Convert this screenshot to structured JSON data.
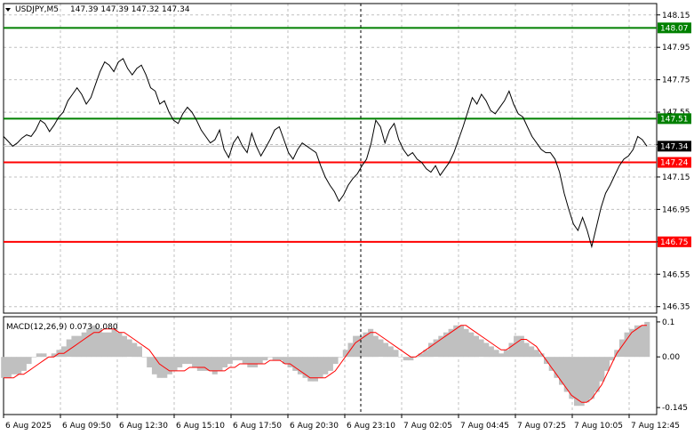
{
  "header": {
    "symbol": "USDJPY,M5",
    "ohlc": "147.39 147.39 147.32 147.34"
  },
  "macd": {
    "title": "MACD(12,26,9) 0.073 0.080",
    "ticks": [
      "0.1",
      "0.00",
      "-0.145"
    ]
  },
  "price_axis": {
    "ticks": [
      "148.15",
      "147.95",
      "147.75",
      "147.55",
      "147.35",
      "147.15",
      "146.95",
      "146.75",
      "146.55",
      "146.35"
    ],
    "range": [
      146.31,
      148.22
    ]
  },
  "time_axis": {
    "labels": [
      "6 Aug 2025",
      "6 Aug 09:50",
      "6 Aug 12:30",
      "6 Aug 15:10",
      "6 Aug 17:50",
      "6 Aug 20:30",
      "6 Aug 23:10",
      "7 Aug 02:05",
      "7 Aug 04:45",
      "7 Aug 07:25",
      "7 Aug 10:05",
      "7 Aug 12:45"
    ]
  },
  "levels": [
    {
      "label": "148.07",
      "value": 148.07,
      "color": "#008000"
    },
    {
      "label": "147.51",
      "value": 147.51,
      "color": "#008000"
    },
    {
      "label": "147.34",
      "value": 147.34,
      "color": "#000000"
    },
    {
      "label": "147.24",
      "value": 147.24,
      "color": "#ff0000"
    },
    {
      "label": "146.75",
      "value": 146.75,
      "color": "#ff0000"
    }
  ],
  "chart_data": {
    "type": "line",
    "series": [
      {
        "values": [
          147.4,
          147.37,
          147.34,
          147.36,
          147.39,
          147.41,
          147.4,
          147.44,
          147.5,
          147.48,
          147.43,
          147.47,
          147.52,
          147.55,
          147.62,
          147.66,
          147.7,
          147.66,
          147.6,
          147.64,
          147.72,
          147.8,
          147.86,
          147.84,
          147.8,
          147.86,
          147.88,
          147.82,
          147.78,
          147.82,
          147.84,
          147.78,
          147.7,
          147.68,
          147.6,
          147.62,
          147.55,
          147.5,
          147.48,
          147.54,
          147.58,
          147.55,
          147.5,
          147.44,
          147.4,
          147.36,
          147.38,
          147.44,
          147.32,
          147.27,
          147.36,
          147.4,
          147.34,
          147.3,
          147.42,
          147.34,
          147.28,
          147.33,
          147.38,
          147.44,
          147.46,
          147.38,
          147.3,
          147.26,
          147.32,
          147.36,
          147.34,
          147.32,
          147.3,
          147.22,
          147.15,
          147.1,
          147.06,
          147.0,
          147.04,
          147.1,
          147.14,
          147.17,
          147.22,
          147.26,
          147.36,
          147.5,
          147.46,
          147.36,
          147.44,
          147.48,
          147.38,
          147.32,
          147.28,
          147.3,
          147.26,
          147.24,
          147.2,
          147.18,
          147.22,
          147.16,
          147.2,
          147.24,
          147.3,
          147.38,
          147.46,
          147.55,
          147.64,
          147.6,
          147.66,
          147.62,
          147.56,
          147.54,
          147.58,
          147.62,
          147.68,
          147.6,
          147.54,
          147.52,
          147.46,
          147.4,
          147.36,
          147.32,
          147.3,
          147.3,
          147.26,
          147.18,
          147.05,
          146.95,
          146.86,
          146.82,
          146.9,
          146.82,
          146.72,
          146.84,
          146.96,
          147.05,
          147.1,
          147.16,
          147.22,
          147.26,
          147.28,
          147.32,
          147.4,
          147.38,
          147.34
        ],
        "color": "#000000"
      }
    ],
    "ylim": [
      146.31,
      148.22
    ],
    "macd_histogram": [
      -0.06,
      -0.06,
      -0.05,
      -0.05,
      -0.04,
      -0.02,
      0.0,
      0.01,
      0.01,
      0.0,
      0.01,
      0.02,
      0.03,
      0.05,
      0.06,
      0.06,
      0.07,
      0.08,
      0.09,
      0.08,
      0.07,
      0.07,
      0.08,
      0.07,
      0.06,
      0.05,
      0.04,
      0.03,
      0.0,
      -0.03,
      -0.05,
      -0.06,
      -0.06,
      -0.05,
      -0.04,
      -0.03,
      -0.02,
      -0.02,
      -0.03,
      -0.04,
      -0.04,
      -0.04,
      -0.05,
      -0.04,
      -0.03,
      -0.02,
      -0.01,
      -0.01,
      -0.02,
      -0.03,
      -0.03,
      -0.02,
      -0.01,
      0.0,
      -0.01,
      -0.01,
      -0.02,
      -0.03,
      -0.04,
      -0.05,
      -0.06,
      -0.07,
      -0.07,
      -0.06,
      -0.05,
      -0.04,
      -0.02,
      0.0,
      0.02,
      0.04,
      0.06,
      0.06,
      0.07,
      0.08,
      0.06,
      0.05,
      0.04,
      0.03,
      0.02,
      0.0,
      -0.01,
      -0.01,
      0.0,
      0.01,
      0.02,
      0.04,
      0.05,
      0.06,
      0.07,
      0.08,
      0.09,
      0.09,
      0.08,
      0.07,
      0.06,
      0.05,
      0.04,
      0.03,
      0.02,
      0.01,
      0.02,
      0.04,
      0.06,
      0.06,
      0.04,
      0.03,
      0.02,
      0.01,
      -0.02,
      -0.04,
      -0.06,
      -0.08,
      -0.1,
      -0.12,
      -0.14,
      -0.14,
      -0.13,
      -0.12,
      -0.1,
      -0.07,
      -0.04,
      -0.01,
      0.02,
      0.05,
      0.07,
      0.08,
      0.09,
      0.09,
      0.1
    ],
    "macd_signal": [
      -0.06,
      -0.06,
      -0.06,
      -0.05,
      -0.05,
      -0.04,
      -0.03,
      -0.02,
      -0.01,
      0.0,
      0.0,
      0.01,
      0.01,
      0.02,
      0.03,
      0.04,
      0.05,
      0.06,
      0.07,
      0.07,
      0.08,
      0.08,
      0.08,
      0.07,
      0.07,
      0.06,
      0.05,
      0.04,
      0.03,
      0.02,
      0.0,
      -0.02,
      -0.03,
      -0.04,
      -0.04,
      -0.04,
      -0.04,
      -0.03,
      -0.03,
      -0.03,
      -0.03,
      -0.04,
      -0.04,
      -0.04,
      -0.04,
      -0.03,
      -0.03,
      -0.02,
      -0.02,
      -0.02,
      -0.02,
      -0.02,
      -0.02,
      -0.01,
      -0.01,
      -0.01,
      -0.02,
      -0.02,
      -0.03,
      -0.04,
      -0.05,
      -0.06,
      -0.06,
      -0.06,
      -0.06,
      -0.05,
      -0.04,
      -0.02,
      0.0,
      0.02,
      0.04,
      0.05,
      0.06,
      0.07,
      0.07,
      0.06,
      0.05,
      0.04,
      0.03,
      0.02,
      0.01,
      0.0,
      0.0,
      0.01,
      0.02,
      0.03,
      0.04,
      0.05,
      0.06,
      0.07,
      0.08,
      0.09,
      0.09,
      0.08,
      0.07,
      0.06,
      0.05,
      0.04,
      0.03,
      0.02,
      0.02,
      0.03,
      0.04,
      0.05,
      0.05,
      0.04,
      0.03,
      0.01,
      -0.01,
      -0.03,
      -0.05,
      -0.07,
      -0.09,
      -0.11,
      -0.12,
      -0.13,
      -0.13,
      -0.12,
      -0.1,
      -0.08,
      -0.05,
      -0.02,
      0.01,
      0.03,
      0.05,
      0.07,
      0.08,
      0.09,
      0.09
    ],
    "macd_ylim": [
      -0.165,
      0.115
    ]
  }
}
